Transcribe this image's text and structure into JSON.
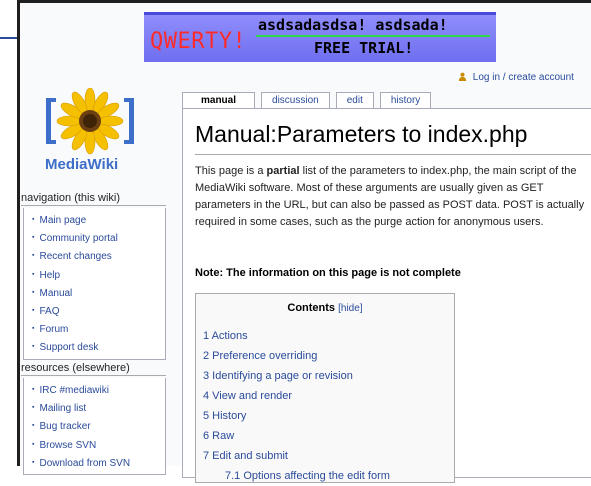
{
  "ad": {
    "logo": "QWERTY!",
    "line1": "asdsadasdsa! asdsada!",
    "line2": "FREE TRIAL!"
  },
  "personal": {
    "user_icon": "user-icon",
    "login_label": "Log in / create account"
  },
  "tabs": [
    {
      "label": "manual"
    },
    {
      "label": "discussion"
    },
    {
      "label": "edit"
    },
    {
      "label": "history"
    }
  ],
  "page": {
    "title": "Manual:Parameters to index.php",
    "intro_a": "This page is a ",
    "intro_bold": "partial",
    "intro_b": " list of the parameters to index.php, the main script of the MediaWiki software. Most of these arguments are usually given as GET parameters in the URL, but can also be passed as POST data. POST is actually required in some cases, such as the purge action for anonymous users.",
    "note": "Note: The information on this page is not complete"
  },
  "toc": {
    "title": "Contents",
    "hide_label": "[hide]",
    "items": [
      "1 Actions",
      "2 Preference overriding",
      "3 Identifying a page or revision",
      "4 View and render",
      "5 History",
      "6 Raw",
      "7 Edit and submit",
      "7.1 Options affecting the edit form"
    ]
  },
  "logo": {
    "text": "MediaWiki"
  },
  "sidebar": {
    "navigation": {
      "heading": "navigation (this wiki)",
      "items": [
        "Main page",
        "Community portal",
        "Recent changes",
        "Help",
        "Manual",
        "FAQ",
        "Forum",
        "Support desk"
      ]
    },
    "resources": {
      "heading": "resources (elsewhere)",
      "items": [
        "IRC #mediawiki",
        "Mailing list",
        "Bug tracker",
        "Browse SVN",
        "Download from SVN"
      ]
    }
  },
  "colors": {
    "link": "#2a4b9a",
    "ad_background": "#7f7df6",
    "ad_logo": "#ff2b2b",
    "logo_text": "#3d6ec9"
  }
}
